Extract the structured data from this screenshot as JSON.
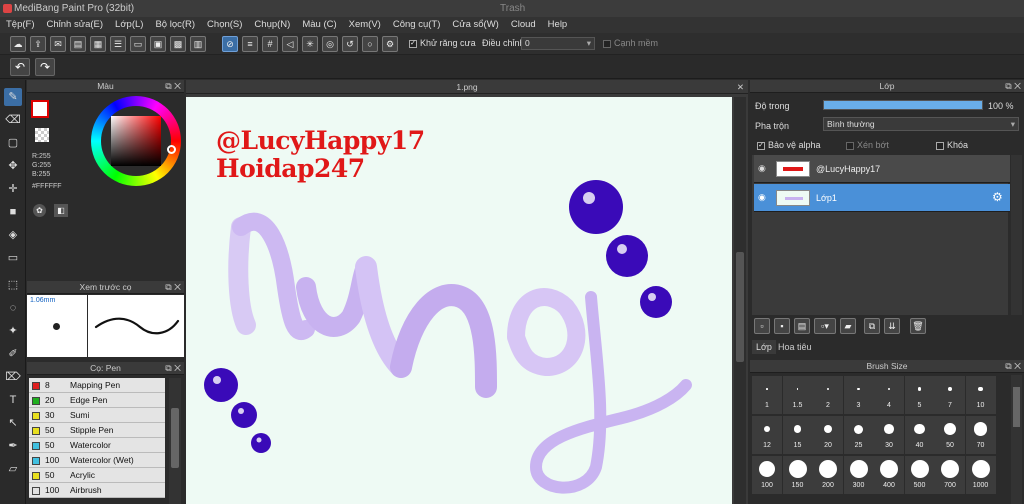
{
  "window": {
    "title": "MediBang Paint Pro (32bit)",
    "center_text": "Trash"
  },
  "menu": [
    "Tệp(F)",
    "Chỉnh sửa(E)",
    "Lớp(L)",
    "Bộ lọc(R)",
    "Chọn(S)",
    "Chụp(N)",
    "Màu (C)",
    "Xem(V)",
    "Công cụ(T)",
    "Cửa sổ(W)",
    "Cloud",
    "Help"
  ],
  "toolbar": {
    "antialias_label": "Khử răng cưa",
    "correction_label": "Điều chỉnh",
    "correction_value": "0",
    "soft_edge_label": "Cạnh mềm"
  },
  "color_panel": {
    "title": "Màu",
    "r": "R:255",
    "g": "G:255",
    "b": "B:255",
    "hex": "#FFFFFF"
  },
  "preview_panel": {
    "title": "Xem trước cọ",
    "size": "1.06mm"
  },
  "brush_panel": {
    "title": "Cọ: Pen",
    "brushes": [
      {
        "size": "8",
        "name": "Mapping Pen",
        "color": "#e02020"
      },
      {
        "size": "20",
        "name": "Edge Pen",
        "color": "#20b020"
      },
      {
        "size": "30",
        "name": "Sumi",
        "color": "#e8e020"
      },
      {
        "size": "50",
        "name": "Stipple Pen",
        "color": "#e8e020"
      },
      {
        "size": "50",
        "name": "Watercolor",
        "color": "#40c0e0"
      },
      {
        "size": "100",
        "name": "Watercolor (Wet)",
        "color": "#40c0e0"
      },
      {
        "size": "50",
        "name": "Acrylic",
        "color": "#e8e020"
      },
      {
        "size": "100",
        "name": "Airbrush",
        "color": "#e0e0e0"
      }
    ]
  },
  "document": {
    "tab": "1.png"
  },
  "canvas": {
    "watermark_line1": "@LucyHappy17",
    "watermark_line2": "Hoidap247",
    "watermark_color": "#e01818",
    "lettering_color": "#cbb8ef"
  },
  "layer_panel": {
    "title": "Lớp",
    "opacity_label": "Độ trong",
    "opacity_value": "100 %",
    "opacity_fraction": 1.0,
    "blend_label": "Pha trộn",
    "blend_value": "Bình thường",
    "protect_alpha": "Bảo vệ alpha",
    "clipping": "Xén bớt",
    "lock": "Khóa",
    "layers": [
      {
        "name": "@LucyHappy17",
        "selected": false
      },
      {
        "name": "Lớp1",
        "selected": true
      }
    ]
  },
  "layer_tabs": [
    "Lớp",
    "Hoa tiêu"
  ],
  "brush_size": {
    "title": "Brush Size",
    "sizes": [
      "1",
      "1.5",
      "2",
      "3",
      "4",
      "5",
      "7",
      "10",
      "12",
      "15",
      "20",
      "25",
      "30",
      "40",
      "50",
      "70",
      "100",
      "150",
      "200",
      "300",
      "400",
      "500",
      "700",
      "1000"
    ]
  }
}
